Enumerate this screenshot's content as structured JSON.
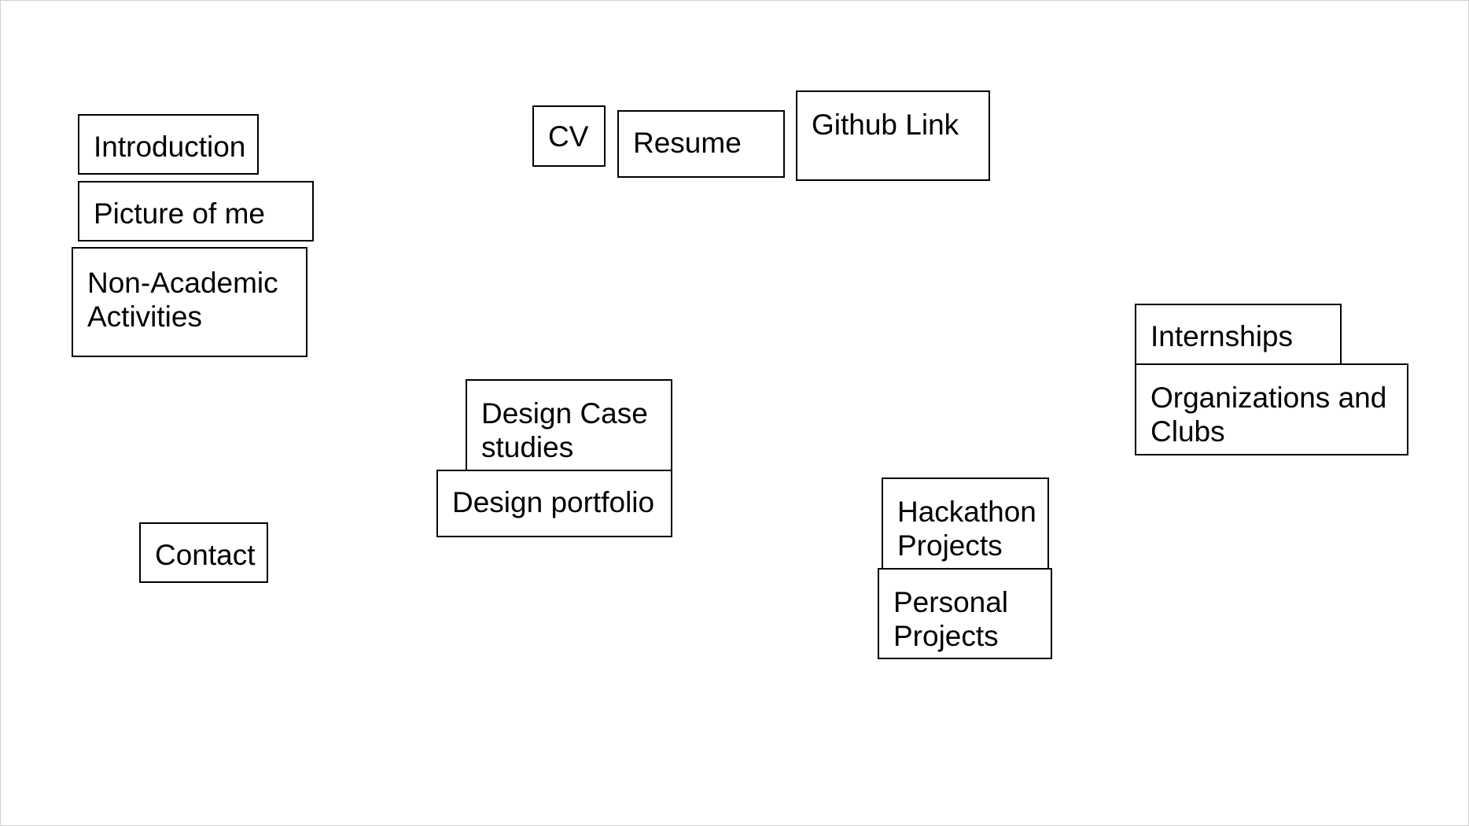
{
  "boxes": {
    "introduction": [
      "Introduction"
    ],
    "picture": [
      "Picture of me"
    ],
    "non_academic": [
      "Non-Academic",
      "Activities"
    ],
    "contact": [
      "Contact"
    ],
    "cv": [
      "CV"
    ],
    "resume": [
      "Resume"
    ],
    "github": [
      "Github Link"
    ],
    "design_case_studies": [
      "Design Case",
      "studies"
    ],
    "design_portfolio": [
      "Design portfolio"
    ],
    "hackathon": [
      "Hackathon",
      "Projects"
    ],
    "personal": [
      "Personal",
      "Projects"
    ],
    "internships": [
      "Internships"
    ],
    "organizations": [
      "Organizations and",
      "Clubs"
    ]
  }
}
